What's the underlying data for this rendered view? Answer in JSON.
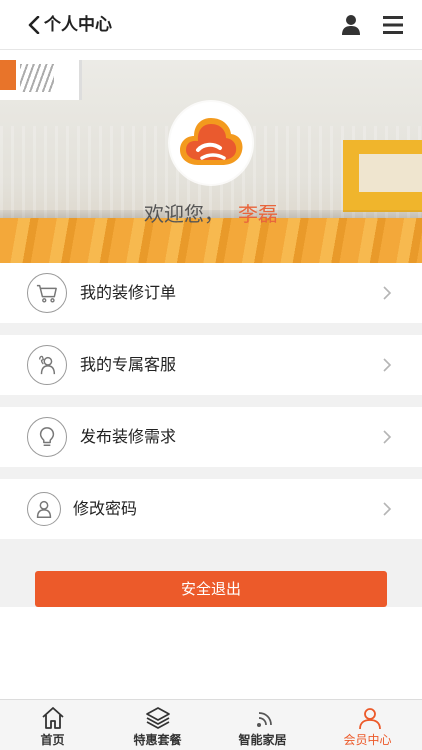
{
  "header": {
    "title": "个人中心",
    "back_icon": "chevron-left-icon",
    "user_icon": "user-icon",
    "menu_icon": "hamburger-menu-icon"
  },
  "banner": {
    "logo_icon": "brand-logo-icon",
    "welcome_text": "欢迎您，",
    "user_name": "李磊"
  },
  "menu": {
    "items": [
      {
        "label": "我的装修订单",
        "icon": "shopping-cart-icon"
      },
      {
        "label": "我的专属客服",
        "icon": "customer-service-icon"
      },
      {
        "label": "发布装修需求",
        "icon": "lightbulb-icon"
      },
      {
        "label": "修改密码",
        "icon": "user-profile-icon"
      }
    ],
    "chevron_icon": "chevron-right-icon"
  },
  "logout_label": "安全退出",
  "tabbar": {
    "tabs": [
      {
        "label": "首页",
        "icon": "home-icon"
      },
      {
        "label": "特惠套餐",
        "icon": "layers-icon"
      },
      {
        "label": "智能家居",
        "icon": "wifi-signal-icon"
      },
      {
        "label": "会员中心",
        "icon": "member-icon"
      }
    ],
    "active_index": 3
  },
  "colors": {
    "accent": "#ec5a2a",
    "name_highlight": "#e8653c"
  }
}
